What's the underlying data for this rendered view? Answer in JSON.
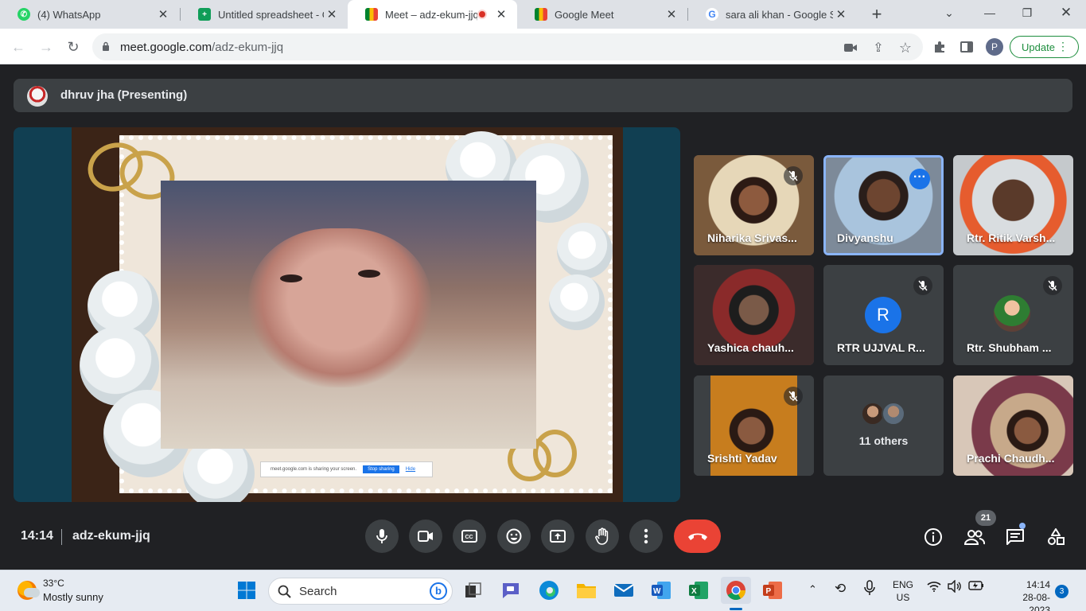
{
  "browser": {
    "tabs": [
      {
        "label": "(4) WhatsApp",
        "favicon": "whatsapp-icon",
        "active": false
      },
      {
        "label": "Untitled spreadsheet - Go",
        "favicon": "sheets-icon",
        "active": false
      },
      {
        "label": "Meet – adz-ekum-jjq",
        "favicon": "meet-icon",
        "active": true,
        "recording": true
      },
      {
        "label": "Google Meet",
        "favicon": "meet-icon",
        "active": false
      },
      {
        "label": "sara ali khan - Google Se",
        "favicon": "google-icon",
        "active": false
      }
    ],
    "url_host": "meet.google.com",
    "url_path": "/adz-ekum-jjq",
    "profile_initial": "P",
    "update_label": "Update"
  },
  "meet": {
    "presenter_title": "dhruv jha (Presenting)",
    "share_banner": {
      "text": "meet.google.com is sharing your screen.",
      "stop_label": "Stop sharing",
      "hide_label": "Hide"
    },
    "participants": [
      {
        "name": "Niharika Srivas...",
        "muted": true,
        "video": true
      },
      {
        "name": "Divyanshu",
        "muted": false,
        "video": true,
        "speaking": true
      },
      {
        "name": "Rtr. Ritik Varsh...",
        "muted": false,
        "video": true
      },
      {
        "name": "Yashica chauh...",
        "muted": false,
        "video": true
      },
      {
        "name": "RTR UJJVAL R...",
        "muted": true,
        "video": false,
        "initial": "R"
      },
      {
        "name": "Rtr. Shubham ...",
        "muted": true,
        "video": false
      },
      {
        "name": "Srishti Yadav",
        "muted": true,
        "video": true
      },
      {
        "name": "11 others",
        "muted": false,
        "video": false
      },
      {
        "name": "Prachi Chaudh...",
        "muted": false,
        "video": true
      }
    ],
    "clock": "14:14",
    "meeting_code": "adz-ekum-jjq",
    "people_count": "21",
    "colors": {
      "hangup": "#ea4335",
      "accent": "#1a73e8",
      "background": "#202124"
    }
  },
  "taskbar": {
    "weather_temp": "33°C",
    "weather_desc": "Mostly sunny",
    "search_label": "Search",
    "lang_top": "ENG",
    "lang_bottom": "US",
    "time": "14:14",
    "date": "28-08-2023",
    "notification_count": "3"
  }
}
